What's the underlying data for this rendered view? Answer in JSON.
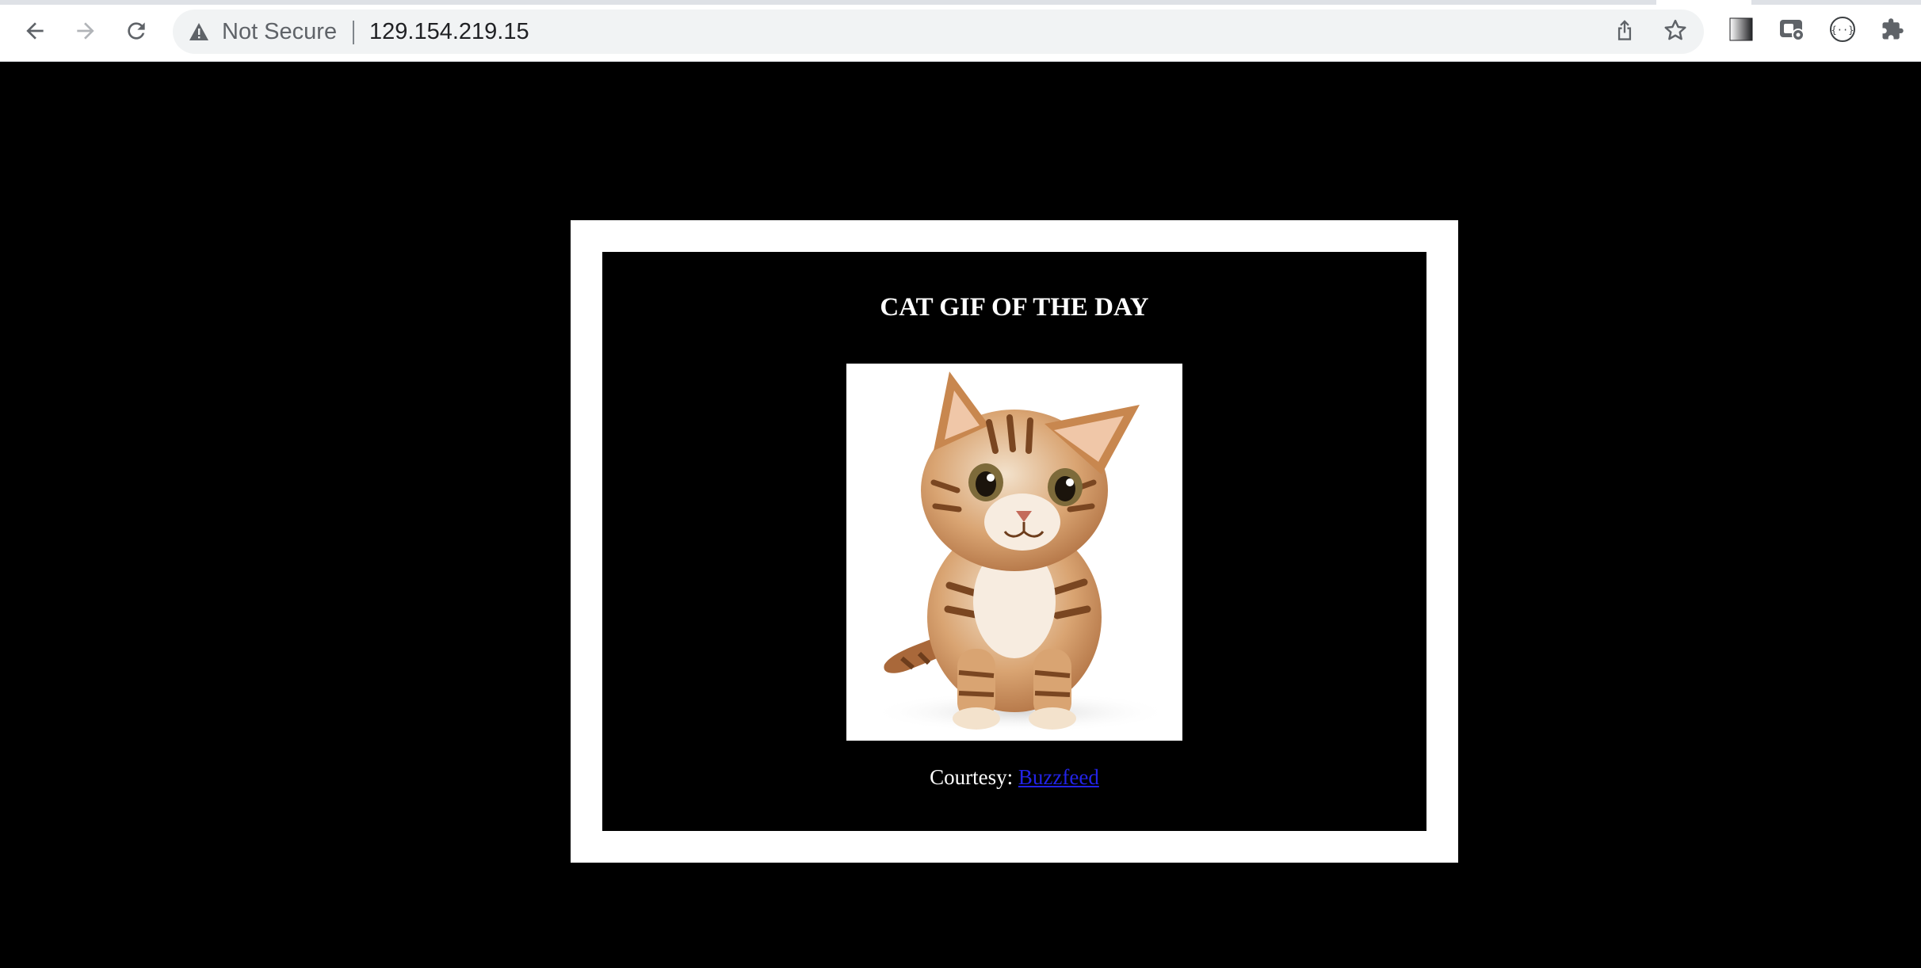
{
  "browser": {
    "security_label": "Not Secure",
    "url": "129.154.219.15",
    "icons": {
      "back": "arrow-left-icon",
      "forward": "arrow-right-icon",
      "reload": "reload-icon",
      "security": "warning-triangle-icon",
      "share": "share-icon",
      "bookmark": "star-icon",
      "extensions": [
        "gradient-extension-icon",
        "screen-capture-extension-icon",
        "code-extension-icon",
        "puzzle-extensions-icon"
      ]
    }
  },
  "page": {
    "title": "CAT GIF OF THE DAY",
    "courtesy_prefix": "Courtesy:",
    "courtesy_link": "Buzzfeed",
    "image": "kitten-image",
    "colors": {
      "background": "#000000",
      "frame": "#ffffff",
      "link": "#2323e6"
    }
  }
}
